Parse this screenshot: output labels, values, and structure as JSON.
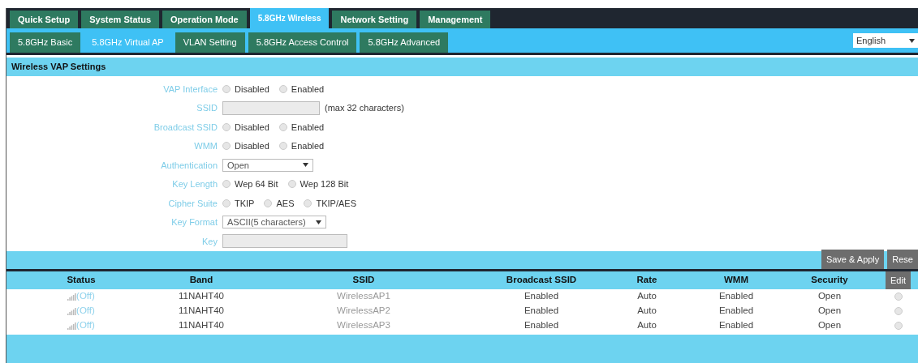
{
  "main_tabs": [
    {
      "label": "Quick Setup",
      "selected": false
    },
    {
      "label": "System Status",
      "selected": false
    },
    {
      "label": "Operation Mode",
      "selected": false
    },
    {
      "label": "5.8GHz Wireless",
      "selected": true
    },
    {
      "label": "Network Setting",
      "selected": false
    },
    {
      "label": "Management",
      "selected": false
    }
  ],
  "sub_tabs": [
    {
      "label": "5.8GHz Basic",
      "selected": false
    },
    {
      "label": "5.8GHz Virtual AP",
      "selected": true
    },
    {
      "label": "VLAN Setting",
      "selected": false
    },
    {
      "label": "5.8GHz Access Control",
      "selected": false
    },
    {
      "label": "5.8GHz Advanced",
      "selected": false
    }
  ],
  "language": {
    "value": "English"
  },
  "section_title": "Wireless VAP Settings",
  "fields": [
    {
      "label": "VAP Interface",
      "kind": "radio",
      "options": [
        {
          "label": "Disabled",
          "selected": false
        },
        {
          "label": "Enabled",
          "selected": false
        }
      ]
    },
    {
      "label": "SSID",
      "kind": "text",
      "note": "(max 32 characters)"
    },
    {
      "label": "Broadcast SSID",
      "kind": "radio",
      "options": [
        {
          "label": "Disabled",
          "selected": false
        },
        {
          "label": "Enabled",
          "selected": false
        }
      ]
    },
    {
      "label": "WMM",
      "kind": "radio",
      "options": [
        {
          "label": "Disabled",
          "selected": false
        },
        {
          "label": "Enabled",
          "selected": false
        }
      ]
    },
    {
      "label": "Authentication",
      "kind": "select",
      "value": "Open"
    },
    {
      "label": "Key Length",
      "kind": "radio",
      "options": [
        {
          "label": "Wep 64 Bit",
          "selected": false
        },
        {
          "label": "Wep 128 Bit",
          "selected": false
        }
      ]
    },
    {
      "label": "Cipher Suite",
      "kind": "radio",
      "options": [
        {
          "label": "TKIP",
          "selected": false
        },
        {
          "label": "AES",
          "selected": false
        },
        {
          "label": "TKIP/AES",
          "selected": false
        }
      ]
    },
    {
      "label": "Key Format",
      "kind": "select",
      "value": "ASCII(5 characters)"
    },
    {
      "label": "Key",
      "kind": "text"
    }
  ],
  "buttons": [
    "Save & Apply",
    "Rese"
  ],
  "table": {
    "columns": [
      "Status",
      "Band",
      "SSID",
      "Broadcast SSID",
      "Rate",
      "WMM",
      "Security",
      "Edit"
    ],
    "rows": [
      {
        "status": "(Off)",
        "band": "11NAHT40",
        "ssid": "WirelessAP1",
        "broadcast_ssid": "Enabled",
        "rate": "Auto",
        "wmm": "Enabled",
        "security": "Open",
        "selected": false
      },
      {
        "status": "(Off)",
        "band": "11NAHT40",
        "ssid": "WirelessAP2",
        "broadcast_ssid": "Enabled",
        "rate": "Auto",
        "wmm": "Enabled",
        "security": "Open",
        "selected": false
      },
      {
        "status": "(Off)",
        "band": "11NAHT40",
        "ssid": "WirelessAP3",
        "broadcast_ssid": "Enabled",
        "rate": "Auto",
        "wmm": "Enabled",
        "security": "Open",
        "selected": false
      }
    ]
  }
}
